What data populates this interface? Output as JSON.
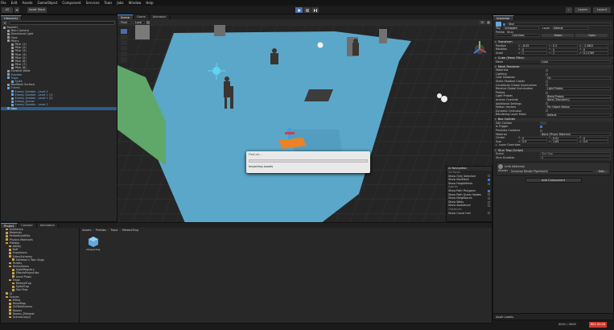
{
  "menubar": [
    "File",
    "Edit",
    "Assets",
    "GameObject",
    "Component",
    "Services",
    "Tools",
    "Jobs",
    "Window",
    "Help"
  ],
  "toolbar": {
    "account": "AS",
    "asset_store": "Asset Store",
    "layers": "Layers",
    "layout": "Layout"
  },
  "scene_tabs": [
    "Scene",
    "Game",
    "Animator"
  ],
  "scene_toolbar": {
    "pivot": "Pivot",
    "local": "Local",
    "mode": "2D"
  },
  "hierarchy": {
    "title": "Hierarchy",
    "items": [
      {
        "label": "Room01",
        "indent": 0,
        "color": "normal"
      },
      {
        "label": "Main Camera",
        "indent": 1,
        "color": "normal"
      },
      {
        "label": "Directional Light",
        "indent": 1,
        "color": "normal"
      },
      {
        "label": "Floor",
        "indent": 1,
        "color": "normal"
      },
      {
        "label": "Pillars",
        "indent": 1,
        "color": "normal"
      },
      {
        "label": "Pillar (1)",
        "indent": 2,
        "color": "normal"
      },
      {
        "label": "Pillar (2)",
        "indent": 2,
        "color": "normal"
      },
      {
        "label": "Pillar (3)",
        "indent": 2,
        "color": "normal"
      },
      {
        "label": "Pillar (4)",
        "indent": 2,
        "color": "normal"
      },
      {
        "label": "Pillar (5)",
        "indent": 2,
        "color": "normal"
      },
      {
        "label": "Pillar (6)",
        "indent": 2,
        "color": "normal"
      },
      {
        "label": "Pillar (7)",
        "indent": 2,
        "color": "normal"
      },
      {
        "label": "Pillar (8)",
        "indent": 2,
        "color": "normal"
      },
      {
        "label": "Invisible Walls",
        "indent": 1,
        "color": "normal"
      },
      {
        "label": "Elevator",
        "indent": 1,
        "color": "blue"
      },
      {
        "label": "Traps",
        "indent": 1,
        "color": "blue"
      },
      {
        "label": "Spike",
        "indent": 2,
        "color": "blue"
      },
      {
        "label": "NavMesh Surface",
        "indent": 1,
        "color": "normal"
      },
      {
        "label": "Enemy",
        "indent": 1,
        "color": "blue"
      },
      {
        "label": "Enemy Zombie - Level 1",
        "indent": 2,
        "color": "blue"
      },
      {
        "label": "Enemy Zombie - Level 1 (1)",
        "indent": 2,
        "color": "blue"
      },
      {
        "label": "Enemy Zombie - Level 1 (2)",
        "indent": 2,
        "color": "blue"
      },
      {
        "label": "Enemy_Archer",
        "indent": 2,
        "color": "blue"
      },
      {
        "label": "Enemy Zombie - Level 2",
        "indent": 2,
        "color": "blue"
      },
      {
        "label": "Stun",
        "indent": 1,
        "color": "selected"
      }
    ]
  },
  "bottom_tabs": [
    "Project",
    "Console",
    "Animation"
  ],
  "project": {
    "breadcrumb": [
      "Assets",
      "Prefabs",
      "Traps",
      "MeleeeTrap"
    ],
    "folders": [
      {
        "label": "Animation",
        "indent": 1
      },
      {
        "label": "Materials",
        "indent": 1
      },
      {
        "label": "PerfabBuildSite",
        "indent": 1
      },
      {
        "label": "Physics Materials",
        "indent": 1
      },
      {
        "label": "Prefabs",
        "indent": 1
      },
      {
        "label": "Ability",
        "indent": 2
      },
      {
        "label": "Buff",
        "indent": 2
      },
      {
        "label": "Explosions",
        "indent": 2
      },
      {
        "label": "Elder/Alchemy",
        "indent": 2
      },
      {
        "label": "Skeleton's Twin Bugs",
        "indent": 3
      },
      {
        "label": "Portals",
        "indent": 2
      },
      {
        "label": "Relics/Items",
        "indent": 2
      },
      {
        "label": "AssetRegistry",
        "indent": 3
      },
      {
        "label": "EffectsProjectiles",
        "indent": 3
      },
      {
        "label": "Level Props",
        "indent": 3
      },
      {
        "label": "Traps",
        "indent": 2
      },
      {
        "label": "MeleeeTrap",
        "indent": 3
      },
      {
        "label": "SpikeTrap",
        "indent": 3
      },
      {
        "label": "StunTrap",
        "indent": 3
      },
      {
        "label": "UI",
        "indent": 1
      },
      {
        "label": "Scenes",
        "indent": 1
      },
      {
        "label": "MTest",
        "indent": 2
      },
      {
        "label": "MoveMap",
        "indent": 2
      },
      {
        "label": "OldTestScenes",
        "indent": 2
      },
      {
        "label": "Rooms",
        "indent": 2
      },
      {
        "label": "Rooms 2Retreat",
        "indent": 2
      },
      {
        "label": "ScenesCopy2",
        "indent": 2
      }
    ],
    "asset_name": "MeleeeTrap"
  },
  "progress_dialog": {
    "header": "Find on...",
    "status": "Importing assets"
  },
  "ai_nav_overlay": {
    "title": "AI Navigation",
    "sections": [
      {
        "label": "Surfaces",
        "heading": true
      },
      {
        "label": "Show Only Selected",
        "checked": false
      },
      {
        "label": "Show NavMesh",
        "checked": true
      },
      {
        "label": "Show HeightMesh",
        "checked": false
      },
      {
        "label": "Agents",
        "heading": true
      },
      {
        "label": "Show Path Polygons",
        "checked": true
      },
      {
        "label": "Show Path Query Nodes",
        "checked": false
      },
      {
        "label": "Show Neighbours",
        "checked": false
      },
      {
        "label": "Show Walls",
        "checked": false
      },
      {
        "label": "Show Avoidance",
        "checked": false
      },
      {
        "label": "Obstacles",
        "heading": true
      },
      {
        "label": "Show Carve Hull",
        "checked": false
      }
    ]
  },
  "inspector": {
    "title": "Inspector",
    "object_name": "Stun",
    "tag_label": "Tag",
    "tag_value": "Untagged",
    "layer_label": "Layer",
    "layer_value": "Default",
    "prefab_label": "Prefab",
    "prefab_value": "Stun",
    "overrides": "Overrides",
    "select": "Select",
    "open": "Open",
    "transform": {
      "title": "Transform",
      "position": {
        "label": "Position",
        "x": "-8.05",
        "y": "0.3",
        "z": "-2.3802"
      },
      "rotation": {
        "label": "Rotation",
        "x": "0",
        "y": "0",
        "z": "0"
      },
      "scale": {
        "label": "Scale",
        "x": "1",
        "y": "1",
        "z": "0.11769"
      }
    },
    "mesh_filter": {
      "title": "Cube (Mesh Filter)",
      "mesh_label": "Mesh",
      "mesh_value": "Cube"
    },
    "mesh_renderer": {
      "title": "Mesh Renderer",
      "rows": [
        {
          "label": "Materials",
          "value": ""
        },
        {
          "label": "Lighting",
          "value": ""
        },
        {
          "label": "Cast Shadows",
          "value": "On"
        },
        {
          "label": "Static Shadow Caster",
          "value": ""
        },
        {
          "label": "Contribute Global Illumination",
          "value": ""
        },
        {
          "label": "Receive Global Illumination",
          "value": "Light Probes"
        },
        {
          "label": "Probes",
          "value": ""
        },
        {
          "label": "Light Probes",
          "value": "Blend Probes"
        },
        {
          "label": "Anchor Override",
          "value": "None (Transform)"
        },
        {
          "label": "Additional Settings",
          "value": ""
        },
        {
          "label": "Motion Vectors",
          "value": "Per Object Motion"
        },
        {
          "label": "Dynamic Occlusion",
          "value": ""
        },
        {
          "label": "Rendering Layer Mask",
          "value": "Default"
        }
      ]
    },
    "box_collider": {
      "title": "Box Collider",
      "edit_label": "Edit Collider",
      "rows": [
        {
          "label": "Is Trigger",
          "value": ""
        },
        {
          "label": "Provides Contacts",
          "value": ""
        },
        {
          "label": "Material",
          "value": "None (Physic Material)"
        }
      ],
      "center": {
        "label": "Center",
        "x": "0",
        "y": "0.92",
        "z": "0"
      },
      "size": {
        "label": "Size",
        "x": "0.9",
        "y": "1.69",
        "z": "0.9"
      },
      "layer_overrides": "Layer Overrides"
    },
    "stun_trap": {
      "title": "Stun Trap (Script)",
      "script_label": "Script",
      "script_value": "StunTrap",
      "duration_label": "Stun Duration",
      "duration_value": "1"
    },
    "material": {
      "name": "Unlit (Material)",
      "shader_label": "Shader",
      "shader_value": "Universal Render Pipeline/Lit",
      "edit": "Edit..."
    },
    "add_component": "Add Component"
  },
  "statusbar": {
    "asset_labels": "Asset Labels",
    "counter": "0001 / 0000",
    "record": "REC 00:00"
  },
  "colors": {
    "accent": "#4a90d8",
    "selection": "#2c5d87",
    "navmesh": "#5ba7c9",
    "trap_orange": "#e8832a",
    "record": "#d03a2a"
  }
}
